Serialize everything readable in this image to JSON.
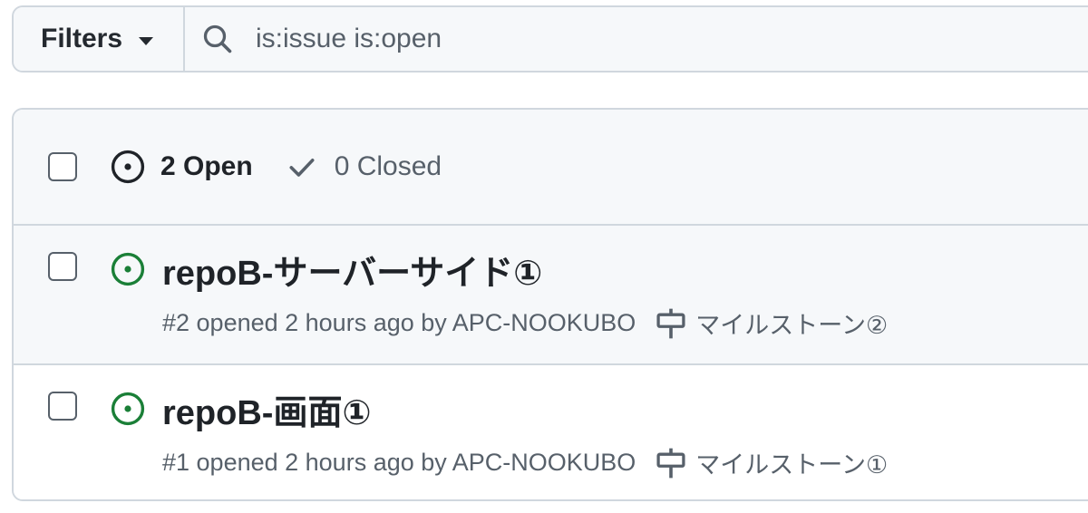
{
  "filters": {
    "label": "Filters"
  },
  "search": {
    "value": "is:issue is:open",
    "icon": "search-icon"
  },
  "header": {
    "open_label": "2 Open",
    "closed_label": "0 Closed"
  },
  "issues": [
    {
      "title": "repoB-サーバーサイド①",
      "meta": "#2 opened 2 hours ago by APC-NOOKUBO",
      "milestone": "マイルストーン②"
    },
    {
      "title": "repoB-画面①",
      "meta": "#1 opened 2 hours ago by APC-NOOKUBO",
      "milestone": "マイルストーン①"
    }
  ],
  "colors": {
    "open_green": "#1a7f37",
    "border": "#d0d7de",
    "muted": "#57606a"
  }
}
